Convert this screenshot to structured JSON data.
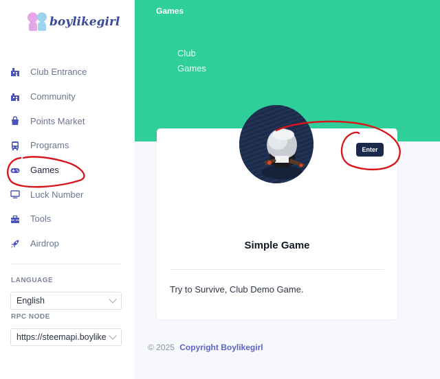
{
  "brand": {
    "name": "boylikegirl"
  },
  "sidebar": {
    "items": [
      {
        "label": "Club Entrance",
        "icon": "club-entrance-icon"
      },
      {
        "label": "Community",
        "icon": "community-icon"
      },
      {
        "label": "Points Market",
        "icon": "shopping-bag-icon"
      },
      {
        "label": "Programs",
        "icon": "bus-icon"
      },
      {
        "label": "Games",
        "icon": "gamepad-icon",
        "active": true
      },
      {
        "label": "Luck Number",
        "icon": "monitor-icon"
      },
      {
        "label": "Tools",
        "icon": "toolbox-icon"
      },
      {
        "label": "Airdrop",
        "icon": "rocket-icon"
      }
    ],
    "language_label": "LANGUAGE",
    "language_value": "English",
    "rpc_label": "RPC NODE",
    "rpc_value": "https://steemapi.boylikegirl.club"
  },
  "header": {
    "title": "Games",
    "breadcrumb": [
      "Club",
      "Games"
    ]
  },
  "card": {
    "title": "Simple Game",
    "description": "Try to Survive, Club Demo Game.",
    "enter_label": "Enter"
  },
  "footer": {
    "copyright": "© 2025",
    "link_text": "Copyright Boylikegirl"
  },
  "colors": {
    "accent_green": "#2ecf98",
    "nav_icon": "#4b55b8",
    "button_dark": "#1b2a4a",
    "annotation_red": "#d8171c"
  }
}
